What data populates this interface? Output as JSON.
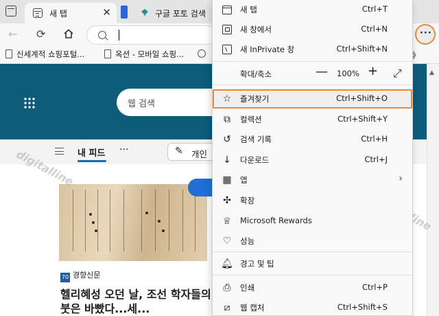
{
  "tabs": [
    {
      "title": "새 탭",
      "close": "✕"
    },
    {
      "title": "구글 포토 검색"
    }
  ],
  "toolbar": {
    "more": "···"
  },
  "favorites": [
    {
      "label": "신세계적 쇼핑포털..."
    },
    {
      "label": "옥션 - 모바일 쇼핑..."
    },
    {
      "label": "G"
    }
  ],
  "favorites_more": "》",
  "page": {
    "search_placeholder": "웹 검색",
    "feed_tab": "내 피드",
    "feed_more": "···",
    "personal_label": "개인",
    "news_source": "경향신문",
    "news_logo": "70",
    "headline": "헬리혜성 오던 날, 조선 학자들의 붓은 바빴다...세..."
  },
  "watermark": "digitalline",
  "menu": {
    "items": [
      {
        "label": "새 탭",
        "shortcut": "Ctrl+T",
        "icon": "new-tab-icon"
      },
      {
        "label": "새 창에서",
        "shortcut": "Ctrl+N",
        "icon": "new-window-icon"
      },
      {
        "label": "새 InPrivate 창",
        "shortcut": "Ctrl+Shift+N",
        "icon": "inprivate-icon"
      },
      {
        "label": "즐겨찾기",
        "shortcut": "Ctrl+Shift+O",
        "icon": "favorites-icon",
        "glyph": "☆"
      },
      {
        "label": "컬렉션",
        "shortcut": "Ctrl+Shift+Y",
        "icon": "collections-icon",
        "glyph": "⧉"
      },
      {
        "label": "검색 기록",
        "shortcut": "Ctrl+H",
        "icon": "history-icon",
        "glyph": "↺"
      },
      {
        "label": "다운로드",
        "shortcut": "Ctrl+J",
        "icon": "download-icon",
        "glyph": "↓"
      },
      {
        "label": "앱",
        "icon": "apps-icon",
        "glyph": "▦",
        "arrow": "›"
      },
      {
        "label": "확장",
        "icon": "extensions-icon",
        "glyph": "✣"
      },
      {
        "label": "Microsoft Rewards",
        "icon": "rewards-icon",
        "glyph": "♕"
      },
      {
        "label": "성능",
        "icon": "performance-icon",
        "glyph": "♡"
      },
      {
        "label": "경고 및 팁",
        "icon": "bell-icon",
        "glyph": "🔔︎"
      },
      {
        "label": "인쇄",
        "shortcut": "Ctrl+P",
        "icon": "print-icon",
        "glyph": "⎙"
      },
      {
        "label": "웹 캡처",
        "shortcut": "Ctrl+Shift+S",
        "icon": "web-capture-icon",
        "glyph": "⧄"
      }
    ],
    "zoom": {
      "label": "확대/축소",
      "minus": "—",
      "value": "100%",
      "plus": "+",
      "fullscreen": "⤢"
    }
  },
  "colors": {
    "highlight": "#e88a3a",
    "hero": "#0c5c7a",
    "accent": "#0f6cbd"
  }
}
